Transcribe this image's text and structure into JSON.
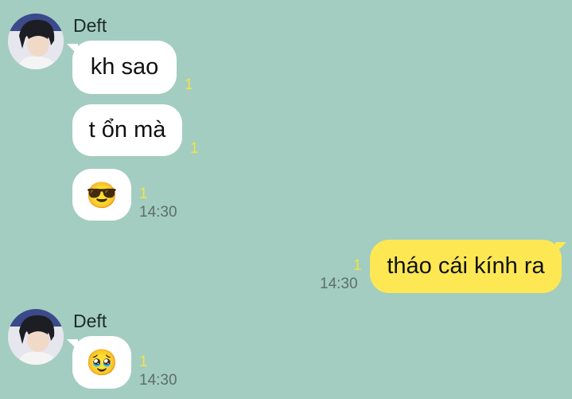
{
  "contact": {
    "name": "Deft",
    "avatar_icon": "profile-photo"
  },
  "colors": {
    "background": "#a3cdc0",
    "incoming_bubble": "#ffffff",
    "outgoing_bubble": "#fde854",
    "unread": "#f4e246"
  },
  "messages": [
    {
      "text": "kh sao",
      "unread": "1"
    },
    {
      "text": "t ổn mà",
      "unread": "1"
    },
    {
      "emoji": "😎",
      "unread": "1",
      "time": "14:30"
    },
    {
      "text": "tháo cái kính ra",
      "unread": "1",
      "time": "14:30"
    },
    {
      "emoji": "🥹",
      "unread": "1",
      "time": "14:30"
    }
  ]
}
